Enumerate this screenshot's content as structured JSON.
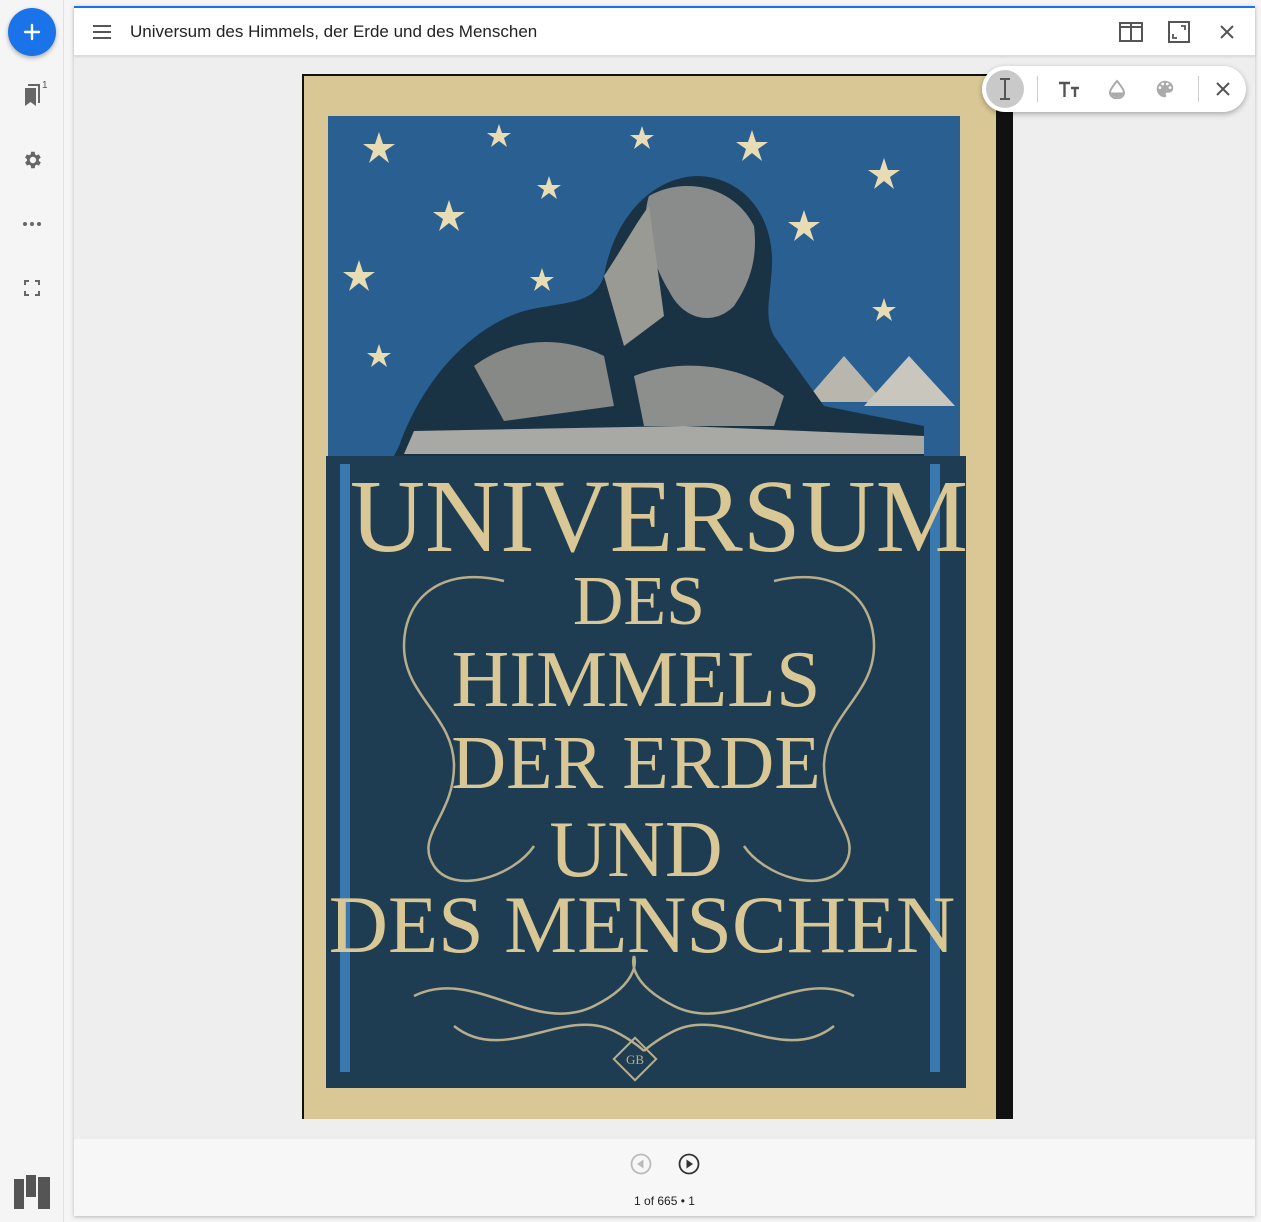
{
  "rail": {
    "bookmark_count": "1"
  },
  "viewer": {
    "title": "Universum des Himmels, der Erde und des Menschen"
  },
  "cover": {
    "title_line1": "UNIVERSUM",
    "title_line2": "DES",
    "title_line3": "HIMMELS",
    "title_line4": "DER ERDE",
    "title_line5": "UND",
    "title_line6": "DES MENSCHEN",
    "publisher_mark": "GB"
  },
  "footer": {
    "pager": "1 of 665 • 1"
  },
  "colors": {
    "accent": "#1a73e8",
    "cover_sky": "#2a5f92",
    "cover_panel": "#1f3d52",
    "cover_cloth": "#d9c895",
    "cover_text": "#d9c895"
  }
}
